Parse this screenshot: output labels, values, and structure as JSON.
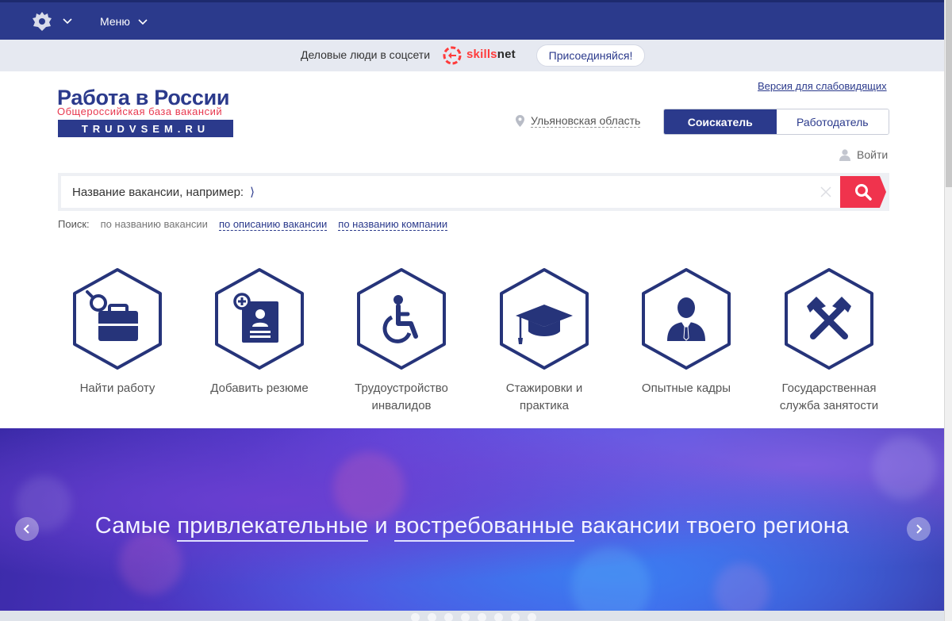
{
  "topbar": {
    "menu_label": "Меню",
    "emblem_icon": "coat-of-arms-icon",
    "bg_color": "#2b3a8c"
  },
  "promo": {
    "text": "Деловые люди в соцсети",
    "brand_prefix": "skills",
    "brand_suffix": "net",
    "join_label": "Присоединяйся!"
  },
  "logo": {
    "title": "Работа в России",
    "subtitle": "Общероссийская база вакансий",
    "domain": "TRUDVSEM.RU"
  },
  "header": {
    "accessible_link": "Версия для слабовидящих",
    "region": "Ульяновская область",
    "roles": [
      {
        "label": "Соискатель",
        "active": true
      },
      {
        "label": "Работодатель",
        "active": false
      }
    ],
    "login_label": "Войти"
  },
  "search": {
    "placeholder": "Название вакансии, например:",
    "suggestion": "⟩",
    "modes_label": "Поиск:",
    "modes": [
      {
        "label": "по названию вакансии",
        "active": true
      },
      {
        "label": "по описанию вакансии",
        "active": false
      },
      {
        "label": "по названию компании",
        "active": false
      }
    ],
    "accent_color": "#f0334d"
  },
  "categories": [
    {
      "label_1": "Найти работу",
      "label_2": "",
      "icon": "briefcase-search-icon"
    },
    {
      "label_1": "Добавить резюме",
      "label_2": "",
      "icon": "add-resume-icon"
    },
    {
      "label_1": "Трудоустройство",
      "label_2": "инвалидов",
      "icon": "wheelchair-icon"
    },
    {
      "label_1": "Стажировки и",
      "label_2": "практика",
      "icon": "graduation-cap-icon"
    },
    {
      "label_1": "Опытные кадры",
      "label_2": "",
      "icon": "businessman-icon"
    },
    {
      "label_1": "Государственная",
      "label_2": "служба занятости",
      "icon": "hammers-icon"
    }
  ],
  "banner": {
    "part1": "Самые ",
    "highlight1": "привлекательные",
    "part2": " и ",
    "highlight2": "востребованные",
    "part3": " вакансии твоего региона"
  }
}
